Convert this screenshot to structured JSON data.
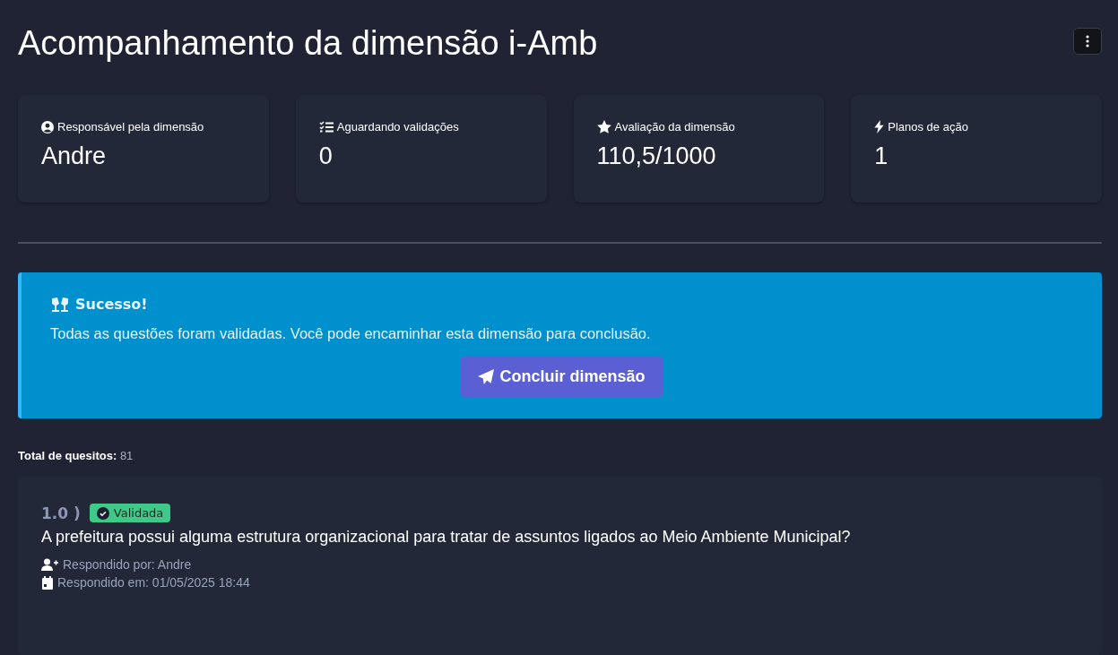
{
  "page": {
    "title": "Acompanhamento da dimensão i-Amb"
  },
  "stats": [
    {
      "label": "Responsável pela dimensão",
      "value": "Andre"
    },
    {
      "label": "Aguardando validações",
      "value": "0"
    },
    {
      "label": "Avaliação da dimensão",
      "value": "110,5/1000"
    },
    {
      "label": "Planos de ação",
      "value": "1"
    }
  ],
  "alert": {
    "title": "Sucesso!",
    "message": "Todas as questões foram validadas. Você pode encaminhar esta dimensão para conclusão.",
    "button": "Concluir dimensão"
  },
  "summary": {
    "label": "Total de quesitos:",
    "value": "81"
  },
  "questions": [
    {
      "number": "1.0 )",
      "status": "Validada",
      "validated": true,
      "text": "A prefeitura possui alguma estrutura organizacional para tratar de assuntos ligados ao Meio Ambiente Municipal?",
      "answered_by": "Respondido por: Andre",
      "answered_at": "Respondido em: 01/05/2025 18:44"
    }
  ]
}
